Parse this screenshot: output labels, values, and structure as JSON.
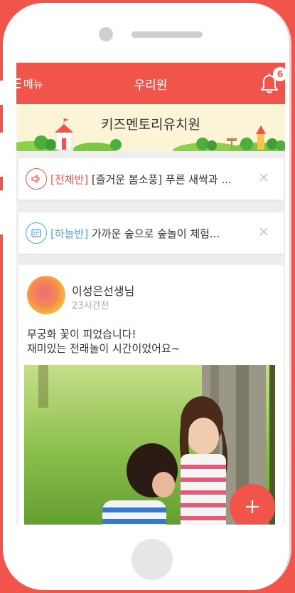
{
  "header": {
    "menu_label": "메뉴",
    "title": "우리원",
    "notification_count": "6"
  },
  "banner": {
    "school_name": "키즈멘토리유치원"
  },
  "notices": [
    {
      "tag": "[전체반]",
      "text": " [즐거운 봄소풍] 푸른 새싹과 ...",
      "icon": "speaker-icon"
    },
    {
      "tag": "[하늘반]",
      "text": " 가까운 숲으로 숲놀이 체험...",
      "icon": "calendar-icon"
    }
  ],
  "post": {
    "author": "이성은선생님",
    "time": "23시간전",
    "lines": [
      "무궁화 꽃이 피었습니다!",
      "재미있는 전래놀이 시간이었어요~"
    ]
  },
  "colors": {
    "accent": "#f0544a",
    "blue_tag": "#49a9e8",
    "banner_bg": "#fbf4d6"
  }
}
